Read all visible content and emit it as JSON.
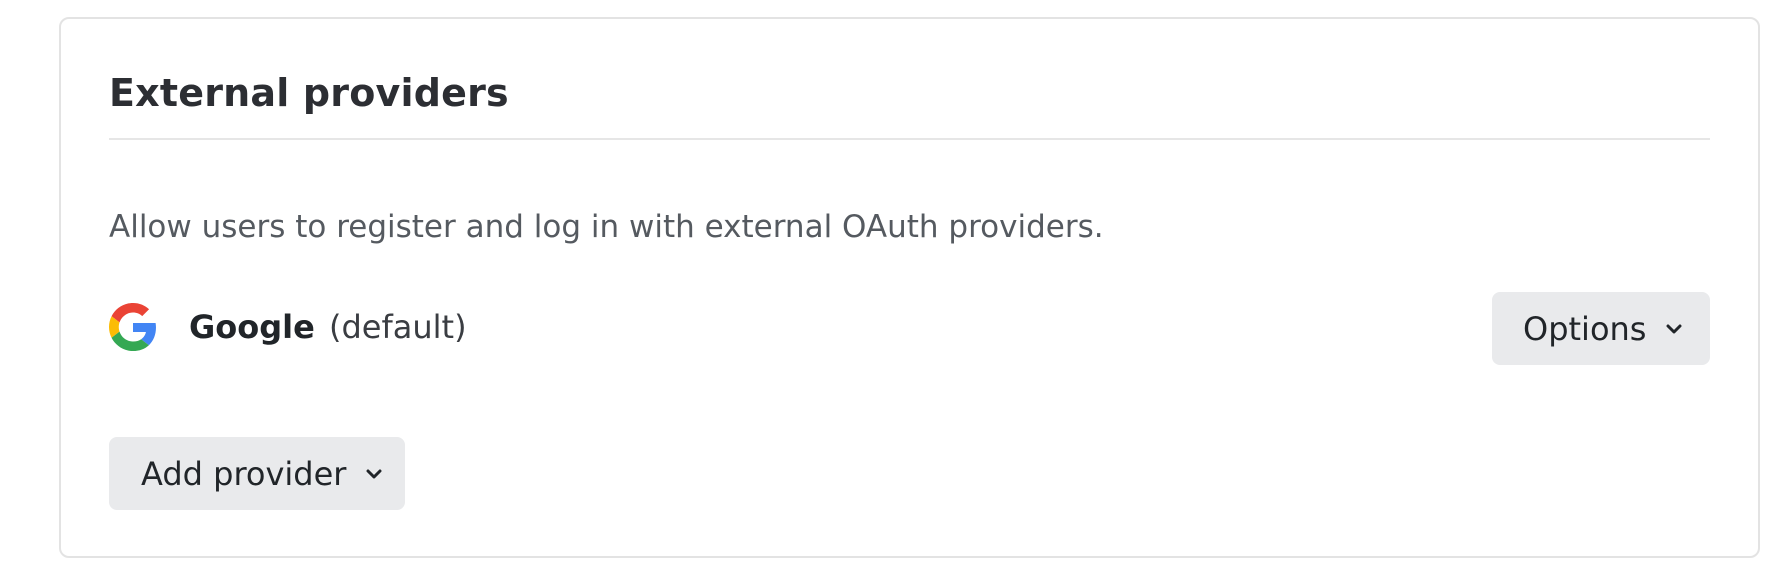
{
  "section": {
    "title": "External providers",
    "description": "Allow users to register and log in with external OAuth providers."
  },
  "providers": [
    {
      "name": "Google",
      "suffix": "(default)",
      "icon": "google-logo-icon",
      "options_label": "Options"
    }
  ],
  "actions": {
    "add_provider_label": "Add provider"
  },
  "icons": {
    "dropdown": "chevron-down-icon"
  },
  "colors": {
    "button_bg": "#e9eaec",
    "title": "#2c2e33",
    "description": "#555a60",
    "google_blue": "#4285F4",
    "google_red": "#EA4335",
    "google_yellow": "#FBBC05",
    "google_green": "#34A853"
  }
}
